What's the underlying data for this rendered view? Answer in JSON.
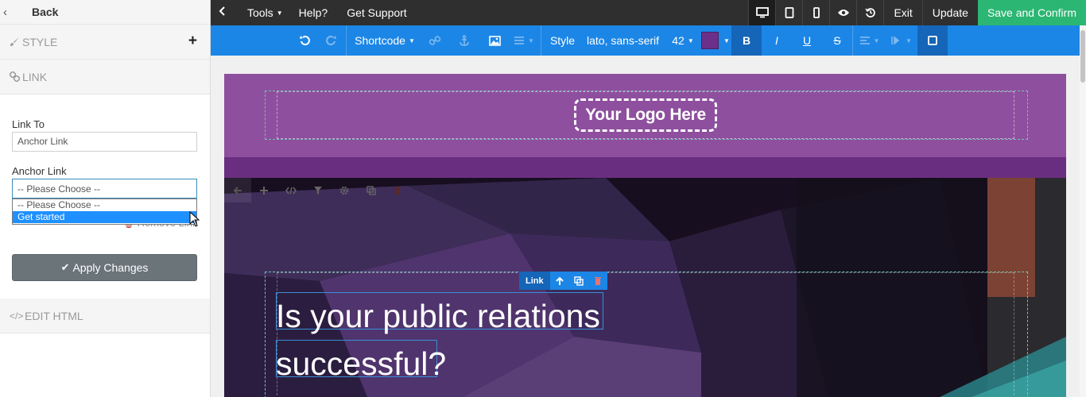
{
  "left_panel": {
    "back_label": "Back",
    "style_label": "STYLE",
    "add_label": "+",
    "link_label": "LINK",
    "link_to_label": "Link To",
    "link_to_value": "Anchor Link",
    "anchor_link_label": "Anchor Link",
    "anchor_select_value": "-- Please Choose --",
    "anchor_options": [
      "-- Please Choose --",
      "Get started"
    ],
    "remove_link_label": "Remove Link",
    "apply_label": "Apply Changes",
    "edit_html_label": "EDIT HTML"
  },
  "topbar": {
    "tools_label": "Tools",
    "help_label": "Help?",
    "support_label": "Get Support",
    "exit_label": "Exit",
    "update_label": "Update",
    "save_label": "Save and Confirm"
  },
  "toolbar": {
    "shortcode_label": "Shortcode",
    "style_label": "Style",
    "font_label": "lato, sans-serif",
    "font_size": "42",
    "text_color": "#6c2f8a",
    "bold_label": "B",
    "italic_label": "I",
    "underline_label": "U",
    "strike_label": "S"
  },
  "canvas": {
    "logo_text": "Your Logo Here",
    "link_toolbar_label": "Link",
    "headline_line1": "Is your public relations",
    "headline_line2": "successful?"
  },
  "colors": {
    "top_bar": "#2f2f2f",
    "toolbar_blue": "#1c86e6",
    "save_green": "#2bb673",
    "header_purple": "#8e4f9e",
    "strip_purple": "#6a2e80",
    "hero_dark": "#170f20"
  }
}
